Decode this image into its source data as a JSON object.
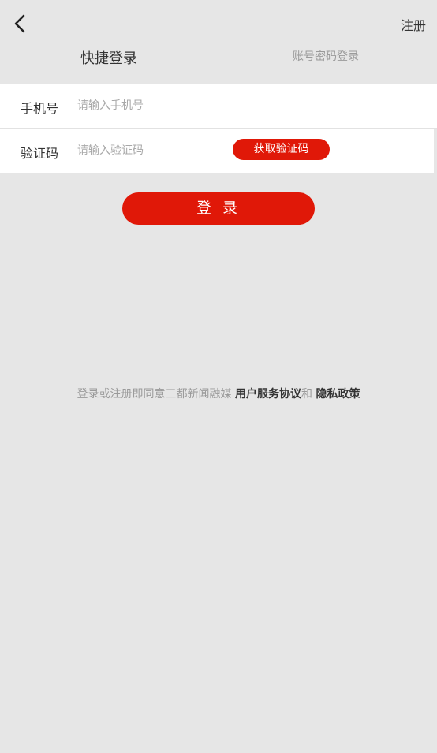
{
  "header": {
    "back_icon": "chevron-left-icon",
    "register_label": "注册"
  },
  "tabs": {
    "quick_login": "快捷登录",
    "password_login": "账号密码登录"
  },
  "form": {
    "phone_label": "手机号",
    "phone_placeholder": "请输入手机号",
    "code_label": "验证码",
    "code_placeholder": "请输入验证码",
    "get_code_label": "获取验证码"
  },
  "login_button_label": "登 录",
  "agreement": {
    "prefix": "登录或注册即同意三都新闻融媒 ",
    "service_link": "用户服务协议",
    "and_text": "和 ",
    "privacy_link": "隐私政策"
  },
  "colors": {
    "accent": "#e01808",
    "background": "#e6e6e6"
  }
}
